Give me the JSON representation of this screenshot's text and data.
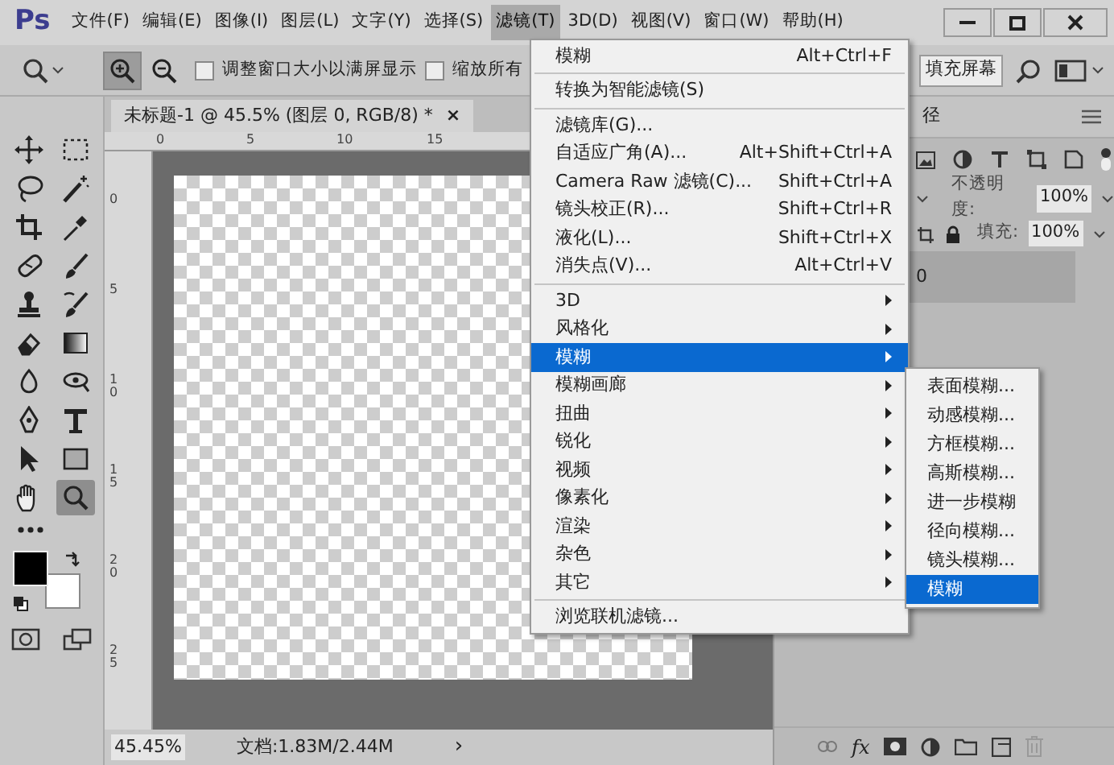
{
  "menubar": {
    "logo": "Ps",
    "items": [
      {
        "label": "文件(F)",
        "selected": false
      },
      {
        "label": "编辑(E)",
        "selected": false
      },
      {
        "label": "图像(I)",
        "selected": false
      },
      {
        "label": "图层(L)",
        "selected": false
      },
      {
        "label": "文字(Y)",
        "selected": false
      },
      {
        "label": "选择(S)",
        "selected": false
      },
      {
        "label": "滤镜(T)",
        "selected": true
      },
      {
        "label": "3D(D)",
        "selected": false
      },
      {
        "label": "视图(V)",
        "selected": false
      },
      {
        "label": "窗口(W)",
        "selected": false
      },
      {
        "label": "帮助(H)",
        "selected": false
      }
    ]
  },
  "options_bar": {
    "zoom_modes": [
      {
        "kind": "zoom-in",
        "selected": true
      },
      {
        "kind": "zoom-out",
        "selected": false
      }
    ],
    "checkboxes": [
      {
        "label": "调整窗口大小以满屏显示",
        "checked": false
      },
      {
        "label": "缩放所有",
        "checked": false
      }
    ],
    "fill_screen_button": "填充屏幕"
  },
  "document_tab": {
    "title": "未标题-1 @ 45.5% (图层 0, RGB/8) *",
    "close": "×"
  },
  "rulers": {
    "horizontal": [
      "0",
      "5",
      "10",
      "15"
    ],
    "vertical": [
      "0",
      "5",
      "1 0",
      "1 5",
      "2 0",
      "2 5"
    ]
  },
  "tools": [
    {
      "kind": "move",
      "selected": false
    },
    {
      "kind": "marquee",
      "selected": false
    },
    {
      "kind": "lasso",
      "selected": false
    },
    {
      "kind": "wand",
      "selected": false
    },
    {
      "kind": "crop",
      "selected": false
    },
    {
      "kind": "eyedropper",
      "selected": false
    },
    {
      "kind": "bandage",
      "selected": false
    },
    {
      "kind": "brush",
      "selected": false
    },
    {
      "kind": "stamp",
      "selected": false
    },
    {
      "kind": "history",
      "selected": false
    },
    {
      "kind": "eraser",
      "selected": false
    },
    {
      "kind": "gradient",
      "selected": false
    },
    {
      "kind": "drop",
      "selected": false
    },
    {
      "kind": "dodge",
      "selected": false
    },
    {
      "kind": "pen",
      "selected": false
    },
    {
      "kind": "type",
      "selected": false
    },
    {
      "kind": "arrow",
      "selected": false
    },
    {
      "kind": "rectangle",
      "selected": false
    },
    {
      "kind": "hand",
      "selected": false
    },
    {
      "kind": "zoom",
      "selected": true
    }
  ],
  "filter_menu": [
    {
      "kind": "item",
      "label": "模糊",
      "shortcut": "Alt+Ctrl+F"
    },
    {
      "kind": "separator"
    },
    {
      "kind": "item",
      "label": "转换为智能滤镜(S)"
    },
    {
      "kind": "separator"
    },
    {
      "kind": "item",
      "label": "滤镜库(G)..."
    },
    {
      "kind": "item",
      "label": "自适应广角(A)...",
      "shortcut": "Alt+Shift+Ctrl+A"
    },
    {
      "kind": "item",
      "label": "Camera Raw 滤镜(C)...",
      "shortcut": "Shift+Ctrl+A"
    },
    {
      "kind": "item",
      "label": "镜头校正(R)...",
      "shortcut": "Shift+Ctrl+R"
    },
    {
      "kind": "item",
      "label": "液化(L)...",
      "shortcut": "Shift+Ctrl+X"
    },
    {
      "kind": "item",
      "label": "消失点(V)...",
      "shortcut": "Alt+Ctrl+V"
    },
    {
      "kind": "separator"
    },
    {
      "kind": "submenu",
      "label": "3D",
      "selected": false
    },
    {
      "kind": "submenu",
      "label": "风格化",
      "selected": false
    },
    {
      "kind": "submenu",
      "label": "模糊",
      "selected": true
    },
    {
      "kind": "submenu",
      "label": "模糊画廊",
      "selected": false
    },
    {
      "kind": "submenu",
      "label": "扭曲",
      "selected": false
    },
    {
      "kind": "submenu",
      "label": "锐化",
      "selected": false
    },
    {
      "kind": "submenu",
      "label": "视频",
      "selected": false
    },
    {
      "kind": "submenu",
      "label": "像素化",
      "selected": false
    },
    {
      "kind": "submenu",
      "label": "渲染",
      "selected": false
    },
    {
      "kind": "submenu",
      "label": "杂色",
      "selected": false
    },
    {
      "kind": "submenu",
      "label": "其它",
      "selected": false
    },
    {
      "kind": "separator"
    },
    {
      "kind": "item",
      "label": "浏览联机滤镜..."
    }
  ],
  "blur_submenu": [
    {
      "label": "表面模糊...",
      "selected": false
    },
    {
      "label": "动感模糊...",
      "selected": false
    },
    {
      "label": "方框模糊...",
      "selected": false
    },
    {
      "label": "高斯模糊...",
      "selected": false
    },
    {
      "label": "进一步模糊",
      "selected": false
    },
    {
      "label": "径向模糊...",
      "selected": false
    },
    {
      "label": "镜头模糊...",
      "selected": false
    },
    {
      "label": "模糊",
      "selected": true
    }
  ],
  "layers_panel": {
    "tab": "径",
    "opacity_label": "不透明度:",
    "opacity": "100%",
    "fill_label": "填充:",
    "fill": "100%",
    "layer_name": "0",
    "bottom_text": "fx"
  },
  "status_bar": {
    "zoom": "45.45%",
    "doc_info": "文档:1.83M/2.44M",
    "arrow": "›"
  }
}
